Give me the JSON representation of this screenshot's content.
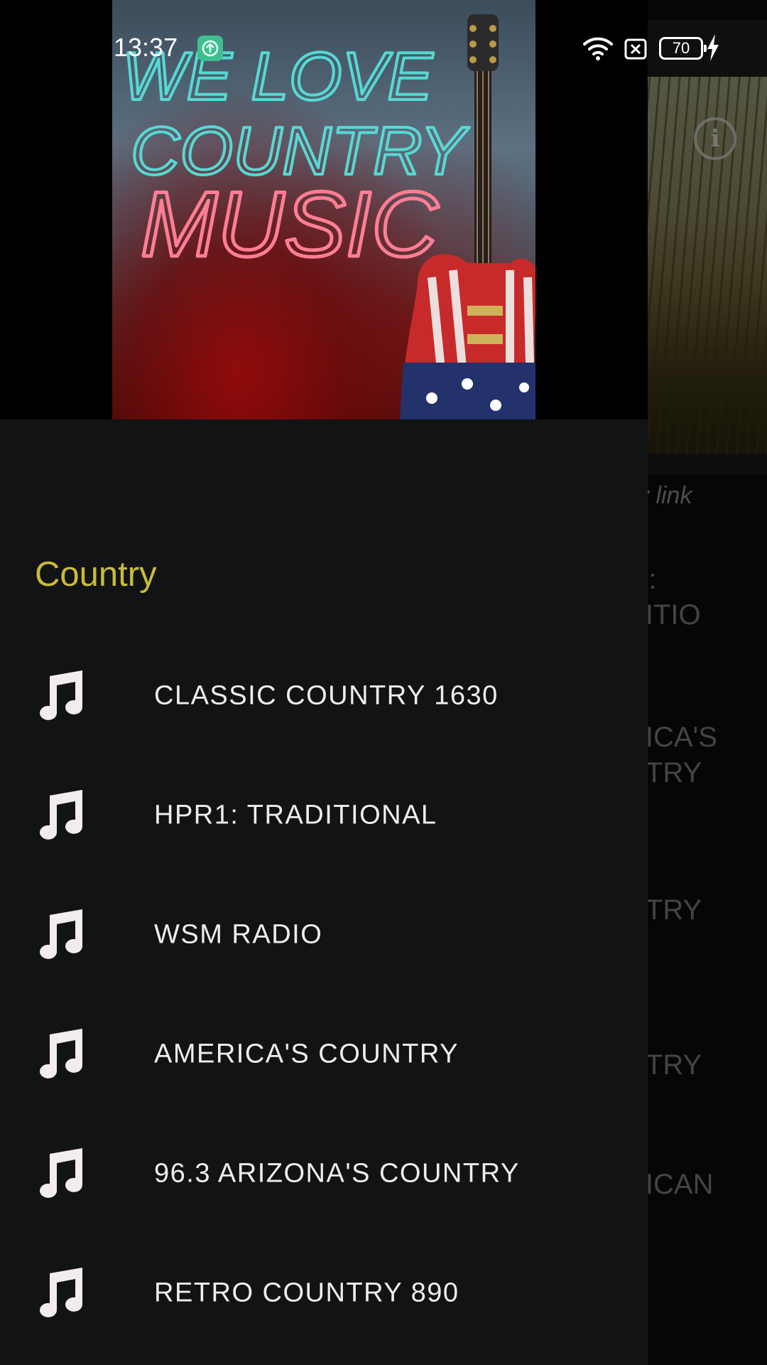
{
  "status_bar": {
    "time": "13:37",
    "battery_level": "70"
  },
  "drawer": {
    "header_image": "we-love-country-music-banner",
    "section_title": "Country",
    "items": [
      {
        "label": "CLASSIC COUNTRY 1630",
        "icon": "music-note-icon"
      },
      {
        "label": "HPR1: TRADITIONAL",
        "icon": "music-note-icon"
      },
      {
        "label": "WSM RADIO",
        "icon": "music-note-icon"
      },
      {
        "label": "AMERICA'S COUNTRY",
        "icon": "music-note-icon"
      },
      {
        "label": "96.3 ARIZONA'S COUNTRY",
        "icon": "music-note-icon"
      },
      {
        "label": "RETRO COUNTRY 890",
        "icon": "music-note-icon"
      }
    ]
  },
  "background": {
    "privacy_link_fragment": "cy link",
    "card_fragments": [
      "   :\nDITIO",
      "RICA'S\nNTRY",
      "O\nNTRY",
      "S\nNTRY\nO",
      "RICAN\n)\nO"
    ]
  },
  "colors": {
    "accent": "#c9bb3a",
    "drawer_bg": "#121314",
    "text": "#eeeeee"
  }
}
